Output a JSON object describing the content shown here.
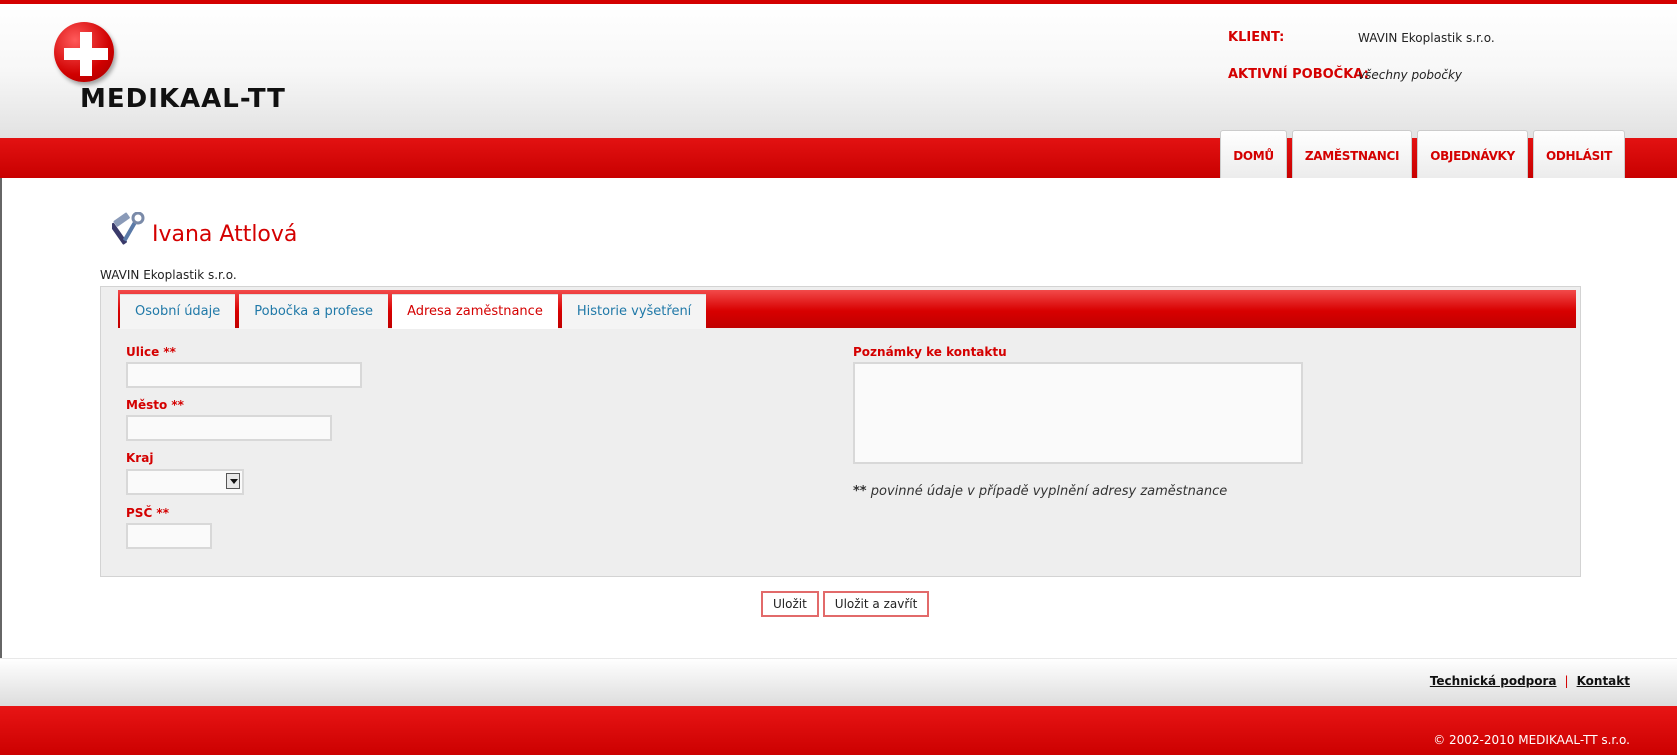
{
  "header": {
    "logo_text": "MEDIKAAL-TT",
    "client_label": "KLIENT:",
    "client_value": "WAVIN Ekoplastik s.r.o.",
    "branch_label": "AKTIVNÍ POBOČKA:",
    "branch_value": "všechny pobočky"
  },
  "nav": {
    "items": [
      {
        "label": "DOMŮ"
      },
      {
        "label": "ZAMĚSTNANCI"
      },
      {
        "label": "OBJEDNÁVKY"
      },
      {
        "label": "ODHLÁSIT"
      }
    ]
  },
  "page": {
    "person_name": "Ivana Attlová",
    "company": "WAVIN Ekoplastik s.r.o."
  },
  "tabs": [
    {
      "label": "Osobní údaje",
      "active": false
    },
    {
      "label": "Pobočka a profese",
      "active": false
    },
    {
      "label": "Adresa zaměstnance",
      "active": true
    },
    {
      "label": "Historie vyšetření",
      "active": false
    }
  ],
  "form": {
    "street_label": "Ulice **",
    "street_value": "",
    "city_label": "Město **",
    "city_value": "",
    "region_label": "Kraj",
    "region_value": "",
    "zip_label": "PSČ **",
    "zip_value": "",
    "notes_label": "Poznámky ke kontaktu",
    "notes_value": "",
    "required_mark": "**",
    "required_note": "povinné údaje v případě vyplnění adresy zaměstnance"
  },
  "actions": {
    "save_label": "Uložit",
    "save_close_label": "Uložit a zavřít"
  },
  "footer": {
    "support_link": "Technická podpora",
    "separator": "|",
    "contact_link": "Kontakt",
    "copyright": "© 2002-2010 MEDIKAAL-TT s.r.o."
  },
  "colors": {
    "brand_red": "#d40000",
    "link_blue": "#2079a8"
  }
}
